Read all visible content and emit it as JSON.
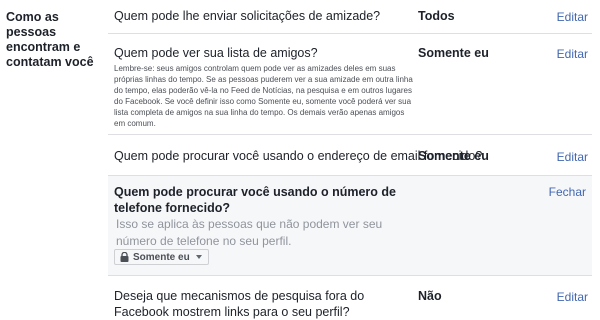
{
  "section": {
    "title": "Como as pessoas encontram e contatam você"
  },
  "rows": [
    {
      "question": "Quem pode lhe enviar solicitações de amizade?",
      "value": "Todos",
      "action": "Editar"
    },
    {
      "question": "Quem pode ver sua lista de amigos?",
      "value": "Somente eu",
      "action": "Editar",
      "note": "Lembre-se: seus amigos controlam quem pode ver as amizades deles em suas próprias linhas do tempo. Se as pessoas puderem ver a sua amizade em outra linha do tempo, elas poderão vê-la no Feed de Notícias, na pesquisa e em outros lugares do Facebook. Se você definir isso como Somente eu, somente você poderá ver sua lista completa de amigos na sua linha do tempo. Os demais verão apenas amigos em comum."
    },
    {
      "question": "Quem pode procurar você usando o endereço de email fornecido?",
      "value": "Somente eu",
      "action": "Editar"
    },
    {
      "question": "Quem pode procurar você usando o número de telefone fornecido?",
      "action": "Fechar",
      "hint": "Isso se aplica às pessoas que não podem ver seu número de telefone no seu perfil.",
      "selector": "Somente eu"
    },
    {
      "question": "Deseja que mecanismos de pesquisa fora do Facebook mostrem links para o seu perfil?",
      "value": "Não",
      "action": "Editar"
    }
  ],
  "icons": {
    "privacy": "lock-icon",
    "dropdown": "caret-down-icon"
  },
  "colors": {
    "link": "#4267b2",
    "expanded_bg": "#f6f7f9",
    "divider": "#dddfe2"
  }
}
